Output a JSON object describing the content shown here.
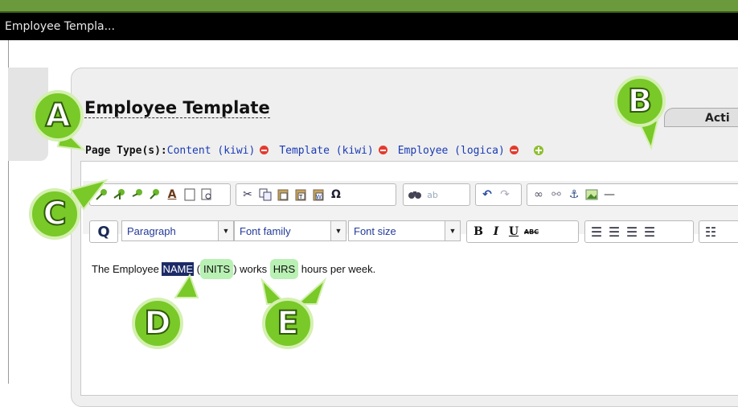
{
  "window": {
    "title": "Employee Templa..."
  },
  "page": {
    "title": "Employee Template",
    "actions_label": "Acti",
    "page_types_label": "Page Type(s):",
    "page_types": [
      "Content (kiwi)",
      "Template (kiwi)",
      "Employee (logica)"
    ]
  },
  "editor": {
    "format_select": "Paragraph",
    "font_family_select": "Font family",
    "font_size_select": "Font size",
    "q_button": "Q",
    "bold": "B",
    "italic": "I",
    "underline": "U",
    "strike": "ABC",
    "content": {
      "before": "The Employee ",
      "name_token": "NAME",
      "paren_open": " (",
      "inits_token": "INITS",
      "middle": ") works ",
      "hrs_token": "HRS",
      "after": " hours per week."
    }
  },
  "callouts": [
    "A",
    "B",
    "C",
    "D",
    "E"
  ],
  "colors": {
    "accent_green": "#79c928",
    "link_blue": "#1a3bb5",
    "remove_red": "#e33b2e",
    "selection_navy": "#1c2a66",
    "token_green": "#b9f0b4"
  },
  "icons": [
    "remove-icon",
    "add-icon",
    "cut-icon",
    "copy-icon",
    "paste-icon",
    "undo-icon",
    "redo-icon",
    "link-icon",
    "unlink-icon",
    "anchor-icon",
    "image-icon",
    "find-icon",
    "omega-icon"
  ]
}
